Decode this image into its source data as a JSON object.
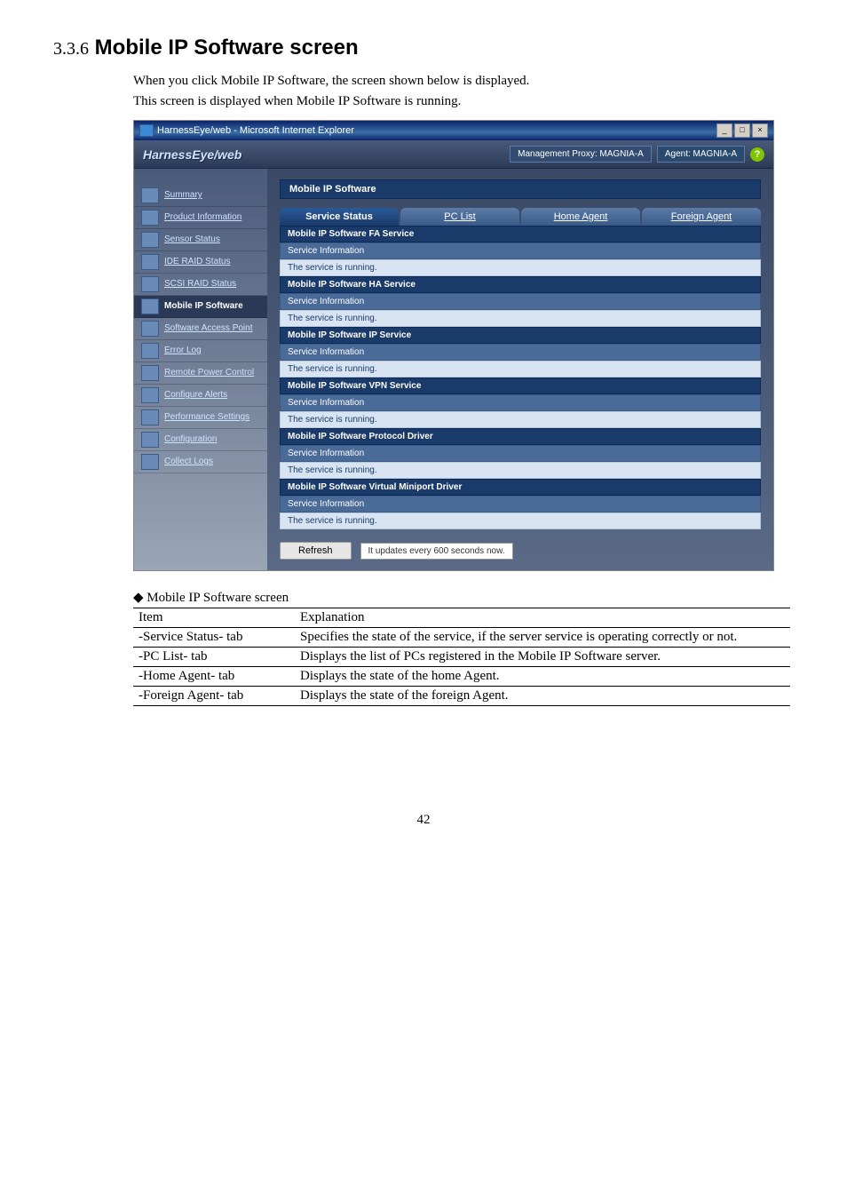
{
  "section": {
    "number": "3.3.6",
    "title": "Mobile IP Software screen"
  },
  "intro": {
    "line1": "When you click Mobile IP Software, the screen shown below is displayed.",
    "line2": "This screen is displayed when Mobile IP Software is running."
  },
  "titlebar": {
    "text": "HarnessEye/web - Microsoft Internet Explorer",
    "min": "_",
    "max": "□",
    "close": "×"
  },
  "header": {
    "logo": "HarnessEye/web",
    "proxy": "Management Proxy: MAGNIA-A",
    "agent": "Agent: MAGNIA-A",
    "help": "?"
  },
  "sidebar": {
    "items": [
      {
        "label": "Summary"
      },
      {
        "label": "Product Information"
      },
      {
        "label": "Sensor Status"
      },
      {
        "label": "IDE RAID Status"
      },
      {
        "label": "SCSI RAID Status"
      },
      {
        "label": "Mobile IP Software"
      },
      {
        "label": "Software Access Point"
      },
      {
        "label": "Error Log"
      },
      {
        "label": "Remote Power Control"
      },
      {
        "label": "Configure Alerts"
      },
      {
        "label": "Performance Settings"
      },
      {
        "label": "Configuration"
      },
      {
        "label": "Collect Logs"
      }
    ]
  },
  "panel": {
    "title": "Mobile IP Software",
    "tabs": [
      {
        "label": "Service Status"
      },
      {
        "label": "PC List"
      },
      {
        "label": "Home Agent"
      },
      {
        "label": "Foreign Agent"
      }
    ],
    "sub_header": "Service Information",
    "running": "The service is running.",
    "services": [
      {
        "name": "Mobile IP Software FA Service"
      },
      {
        "name": "Mobile IP Software HA Service"
      },
      {
        "name": "Mobile IP Software IP Service"
      },
      {
        "name": "Mobile IP Software VPN Service"
      },
      {
        "name": "Mobile IP Software Protocol Driver"
      },
      {
        "name": "Mobile IP Software Virtual Miniport Driver"
      }
    ],
    "refresh": {
      "button": "Refresh",
      "note": "It updates every 600 seconds now."
    }
  },
  "doc_table": {
    "caption": "◆ Mobile IP Software screen",
    "headers": {
      "col1": "Item",
      "col2": "Explanation"
    },
    "rows": [
      {
        "item": "-Service Status- tab",
        "exp": "Specifies the state of the service, if the server service is operating correctly or not."
      },
      {
        "item": "-PC List- tab",
        "exp": "Displays the list of PCs registered in the Mobile IP Software server."
      },
      {
        "item": "-Home Agent- tab",
        "exp": "Displays the state of the home Agent."
      },
      {
        "item": "-Foreign Agent- tab",
        "exp": "Displays the state of the foreign Agent."
      }
    ]
  },
  "page_number": "42"
}
